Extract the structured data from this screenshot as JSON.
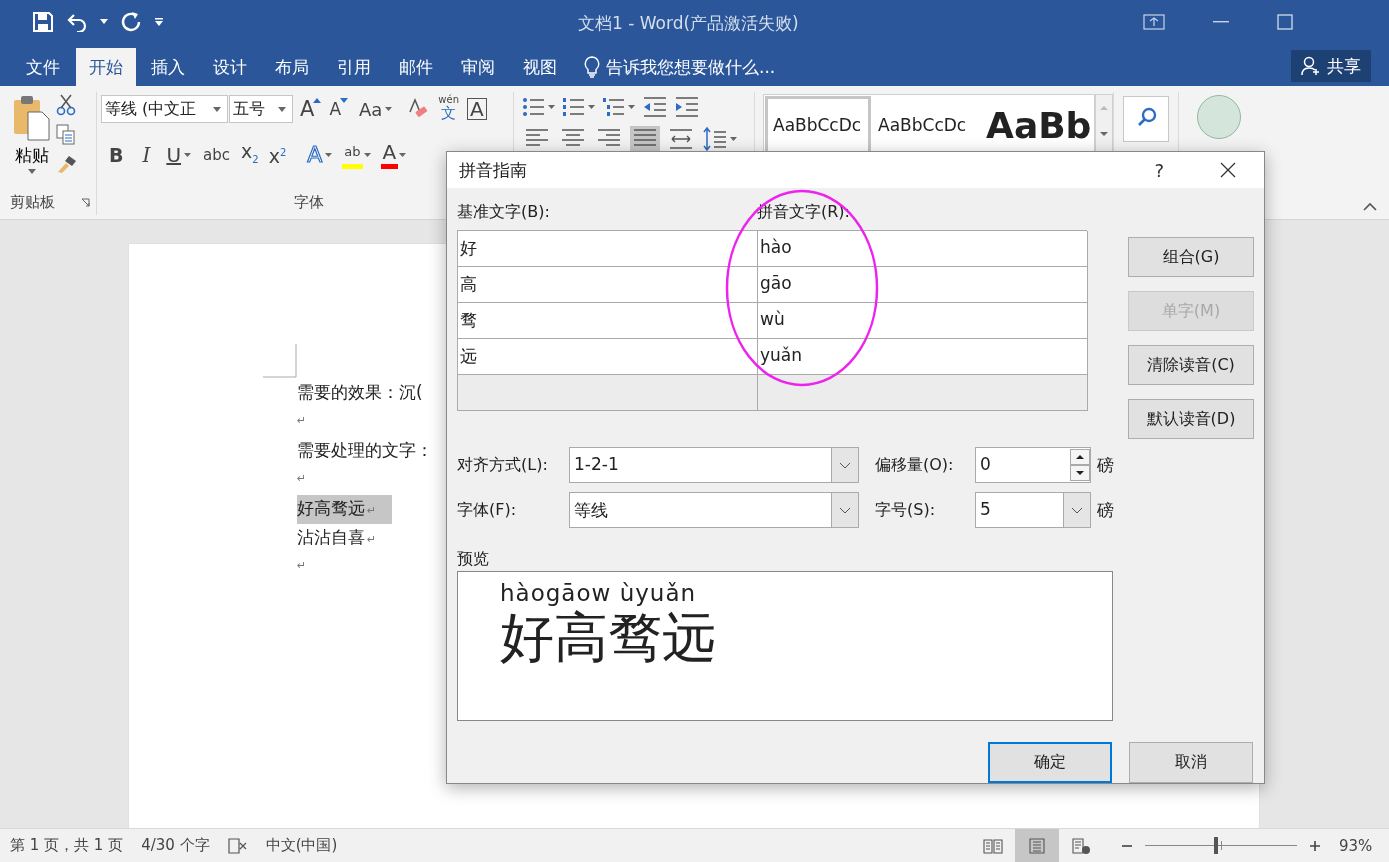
{
  "window": {
    "title": "文档1 - Word(产品激活失败)"
  },
  "ribbon_tabs": [
    {
      "label": "文件",
      "selected": false
    },
    {
      "label": "开始",
      "selected": true
    },
    {
      "label": "插入",
      "selected": false
    },
    {
      "label": "设计",
      "selected": false
    },
    {
      "label": "布局",
      "selected": false
    },
    {
      "label": "引用",
      "selected": false
    },
    {
      "label": "邮件",
      "selected": false
    },
    {
      "label": "审阅",
      "selected": false
    },
    {
      "label": "视图",
      "selected": false
    }
  ],
  "tell_me": "告诉我您想要做什么...",
  "share": "共享",
  "clipboard": {
    "paste": "粘贴",
    "group_label": "剪贴板"
  },
  "font_group": {
    "font_name": "等线 (中文正",
    "font_size": "五号",
    "group_label": "字体",
    "row1": [
      {
        "kind": "grow",
        "glyph": "A"
      },
      {
        "kind": "shrink",
        "glyph": "A"
      },
      {
        "kind": "case",
        "glyph": "Aa",
        "dropdown": true
      },
      {
        "kind": "clear"
      },
      {
        "kind": "ruby",
        "glyph": "文",
        "top": "wén"
      },
      {
        "kind": "border",
        "glyph": "A"
      }
    ],
    "row2": [
      {
        "kind": "bold",
        "glyph": "B"
      },
      {
        "kind": "italic",
        "glyph": "I"
      },
      {
        "kind": "underline",
        "glyph": "U",
        "dropdown": true
      },
      {
        "kind": "strike",
        "glyph": "abc"
      },
      {
        "kind": "sub",
        "glyph": "x",
        "index": "2"
      },
      {
        "kind": "sup",
        "glyph": "x",
        "index": "2"
      },
      {
        "kind": "effects",
        "glyph": "A",
        "dropdown": true
      },
      {
        "kind": "highlight",
        "glyph": "ab",
        "color": "#ffff00",
        "dropdown": true
      },
      {
        "kind": "fontcolor",
        "glyph": "A",
        "color": "#ff0000",
        "dropdown": true
      }
    ]
  },
  "paragraph_align": [
    {
      "selected": false
    },
    {
      "selected": false
    },
    {
      "selected": false
    },
    {
      "selected": true
    },
    {
      "selected": false
    }
  ],
  "styles": [
    {
      "sample": "AaBbCcDc",
      "selected": true,
      "kind": "normal"
    },
    {
      "sample": "AaBbCcDc",
      "selected": false,
      "kind": "normal"
    },
    {
      "sample": "AaBb",
      "selected": false,
      "kind": "heading"
    }
  ],
  "document": {
    "paragraphs": [
      {
        "text": "需要的效果：沉("
      },
      {
        "mark": "↵"
      },
      {
        "text": "需要处理的文字："
      },
      {
        "mark": "↵"
      },
      {
        "text": "好高骛远",
        "mark": "↵",
        "highlighted": true
      },
      {
        "text": "沾沾自喜",
        "mark": "↵",
        "highlighted": false
      },
      {
        "mark": "↵"
      }
    ]
  },
  "status_bar": {
    "page": "第 1 页，共 1 页",
    "words": "4/30 个字",
    "language": "中文(中国)",
    "zoom": "93%",
    "level": 0.47,
    "views": [
      {
        "kind": "read",
        "selected": false
      },
      {
        "kind": "print",
        "selected": true
      },
      {
        "kind": "web",
        "selected": false
      }
    ]
  },
  "dialog": {
    "title": "拼音指南",
    "help": "?",
    "base_label": "基准文字(B):",
    "ruby_label": "拼音文字(R):",
    "rows": [
      {
        "base": "好",
        "ruby": "hào",
        "disabled": false
      },
      {
        "base": "高",
        "ruby": "gāo",
        "disabled": false
      },
      {
        "base": "骛",
        "ruby": "wù",
        "disabled": false
      },
      {
        "base": "远",
        "ruby": "yuǎn",
        "disabled": false
      },
      {
        "disabled": true
      }
    ],
    "buttons": [
      {
        "label": "组合(G)",
        "disabled": false
      },
      {
        "label": "单字(M)",
        "disabled": true
      },
      {
        "label": "清除读音(C)",
        "disabled": false
      },
      {
        "label": "默认读音(D)",
        "disabled": false
      }
    ],
    "alignment": {
      "label": "对齐方式(L):",
      "value": "1-2-1"
    },
    "offset": {
      "label": "偏移量(O):",
      "value": "0",
      "unit": "磅"
    },
    "font": {
      "label": "字体(F):",
      "value": "等线"
    },
    "size": {
      "label": "字号(S):",
      "value": "5",
      "unit": "磅"
    },
    "preview": {
      "label": "预览",
      "ruby": "hàogāow ùyuǎn",
      "base": "好高骛远"
    },
    "ok": "确定",
    "cancel": "取消"
  }
}
